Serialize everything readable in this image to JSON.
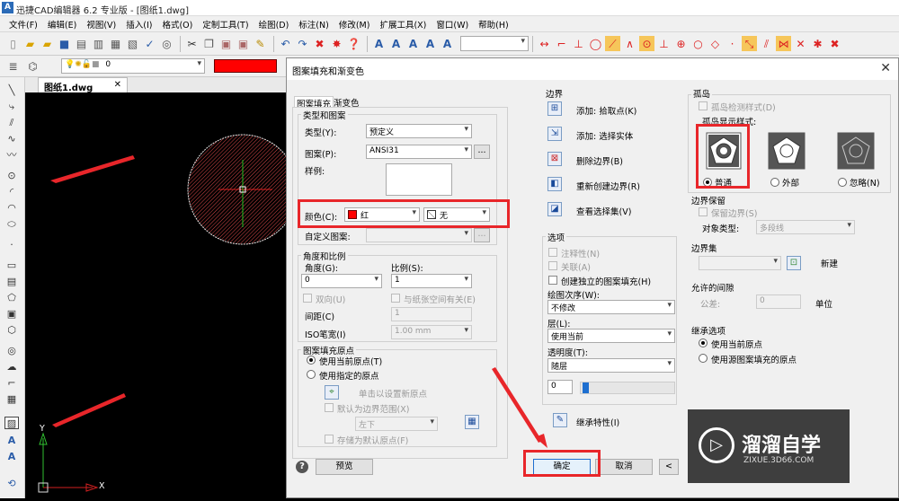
{
  "app": {
    "logo": "A",
    "title": "迅捷CAD编辑器 6.2 专业版 - [图纸1.dwg]"
  },
  "menu": [
    "文件(F)",
    "编辑(E)",
    "视图(V)",
    "插入(I)",
    "格式(O)",
    "定制工具(T)",
    "绘图(D)",
    "标注(N)",
    "修改(M)",
    "扩展工具(X)",
    "窗口(W)",
    "帮助(H)"
  ],
  "layer_value": "0",
  "doc_tab": "图纸1.dwg",
  "doc_tab_close": "✕",
  "axis": {
    "y": "Y",
    "x": "X"
  },
  "colors": {
    "accent_red": "#e8262a",
    "layer_red": "#ff0000",
    "hatch_circle": "#d94848"
  },
  "dialog": {
    "title": "图案填充和渐变色",
    "tabs": [
      "图案填充",
      "渐变色"
    ],
    "type_pattern": {
      "legend": "类型和图案",
      "type_label": "类型(Y):",
      "type_value": "预定义",
      "pattern_label": "图案(P):",
      "pattern_value": "ANSI31",
      "ellipsis": "...",
      "sample_label": "样例:",
      "color_label": "颜色(C):",
      "color_value": "红",
      "bg_value": "无",
      "custom_label": "自定义图案:"
    },
    "angle_scale": {
      "legend": "角度和比例",
      "angle_label": "角度(G):",
      "angle_value": "0",
      "scale_label": "比例(S):",
      "scale_value": "1",
      "double_label": "双向(U)",
      "relative_label": "与纸张空间有关(E)",
      "spacing_label": "间距(C)",
      "spacing_value": "1",
      "iso_label": "ISO笔宽(I)",
      "iso_value": "1.00 mm"
    },
    "origin": {
      "legend": "图案填充原点",
      "use_current": "使用当前原点(T)",
      "use_specified": "使用指定的原点",
      "click_set": "单击以设置新原点",
      "default_boundary": "默认为边界范围(X)",
      "position_value": "左下",
      "store_default": "存储为默认原点(F)"
    },
    "boundary": {
      "legend": "边界",
      "items": [
        "添加: 拾取点(K)",
        "添加: 选择实体",
        "删除边界(B)",
        "重新创建边界(R)",
        "查看选择集(V)"
      ]
    },
    "options": {
      "legend": "选项",
      "annotative": "注释性(N)",
      "associative": "关联(A)",
      "independent": "创建独立的图案填充(H)",
      "draw_order_label": "绘图次序(W):",
      "draw_order_value": "不修改",
      "layer_label": "层(L):",
      "layer_value": "使用当前",
      "transparency_label": "透明度(T):",
      "transparency_value": "随层",
      "transparency_num": "0"
    },
    "inherit": "继承特性(I)",
    "islands": {
      "legend": "孤岛",
      "detect": "孤岛检测样式(D)",
      "style_label": "孤岛显示样式:",
      "styles": [
        "普通",
        "外部",
        "忽略(N)"
      ]
    },
    "boundary_retain": {
      "legend": "边界保留",
      "retain": "保留边界(S)",
      "obj_type_label": "对象类型:",
      "obj_type_value": "多段线"
    },
    "boundary_set": {
      "legend": "边界集",
      "new": "新建"
    },
    "gap": {
      "legend": "允许的间隙",
      "tolerance_label": "公差:",
      "tolerance_value": "0",
      "unit": "单位"
    },
    "inherit_options": {
      "legend": "继承选项",
      "use_current": "使用当前原点",
      "use_source": "使用源图案填充的原点"
    },
    "buttons": {
      "help": "?",
      "preview": "预览",
      "ok": "确定",
      "cancel": "取消",
      "more": "<"
    }
  },
  "watermark": {
    "brand": "溜溜自学",
    "url": "ZIXUE.3D66.COM"
  }
}
